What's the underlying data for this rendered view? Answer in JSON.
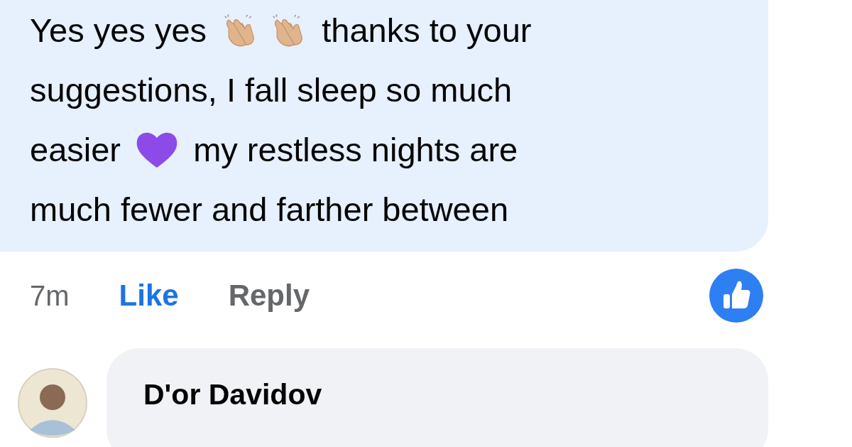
{
  "comments": [
    {
      "lines": [
        [
          "Yes yes yes ",
          {
            "kind": "clap"
          },
          {
            "kind": "clap"
          },
          " thanks to your"
        ],
        [
          "suggestions, I fall sleep so much"
        ],
        [
          "easier ",
          {
            "kind": "heart"
          },
          " my restless nights are"
        ],
        [
          "much fewer and farther between"
        ]
      ],
      "time": "7m",
      "like_label": "Like",
      "liked": true,
      "reply_label": "Reply"
    },
    {
      "author": "D'or Davidov"
    }
  ]
}
